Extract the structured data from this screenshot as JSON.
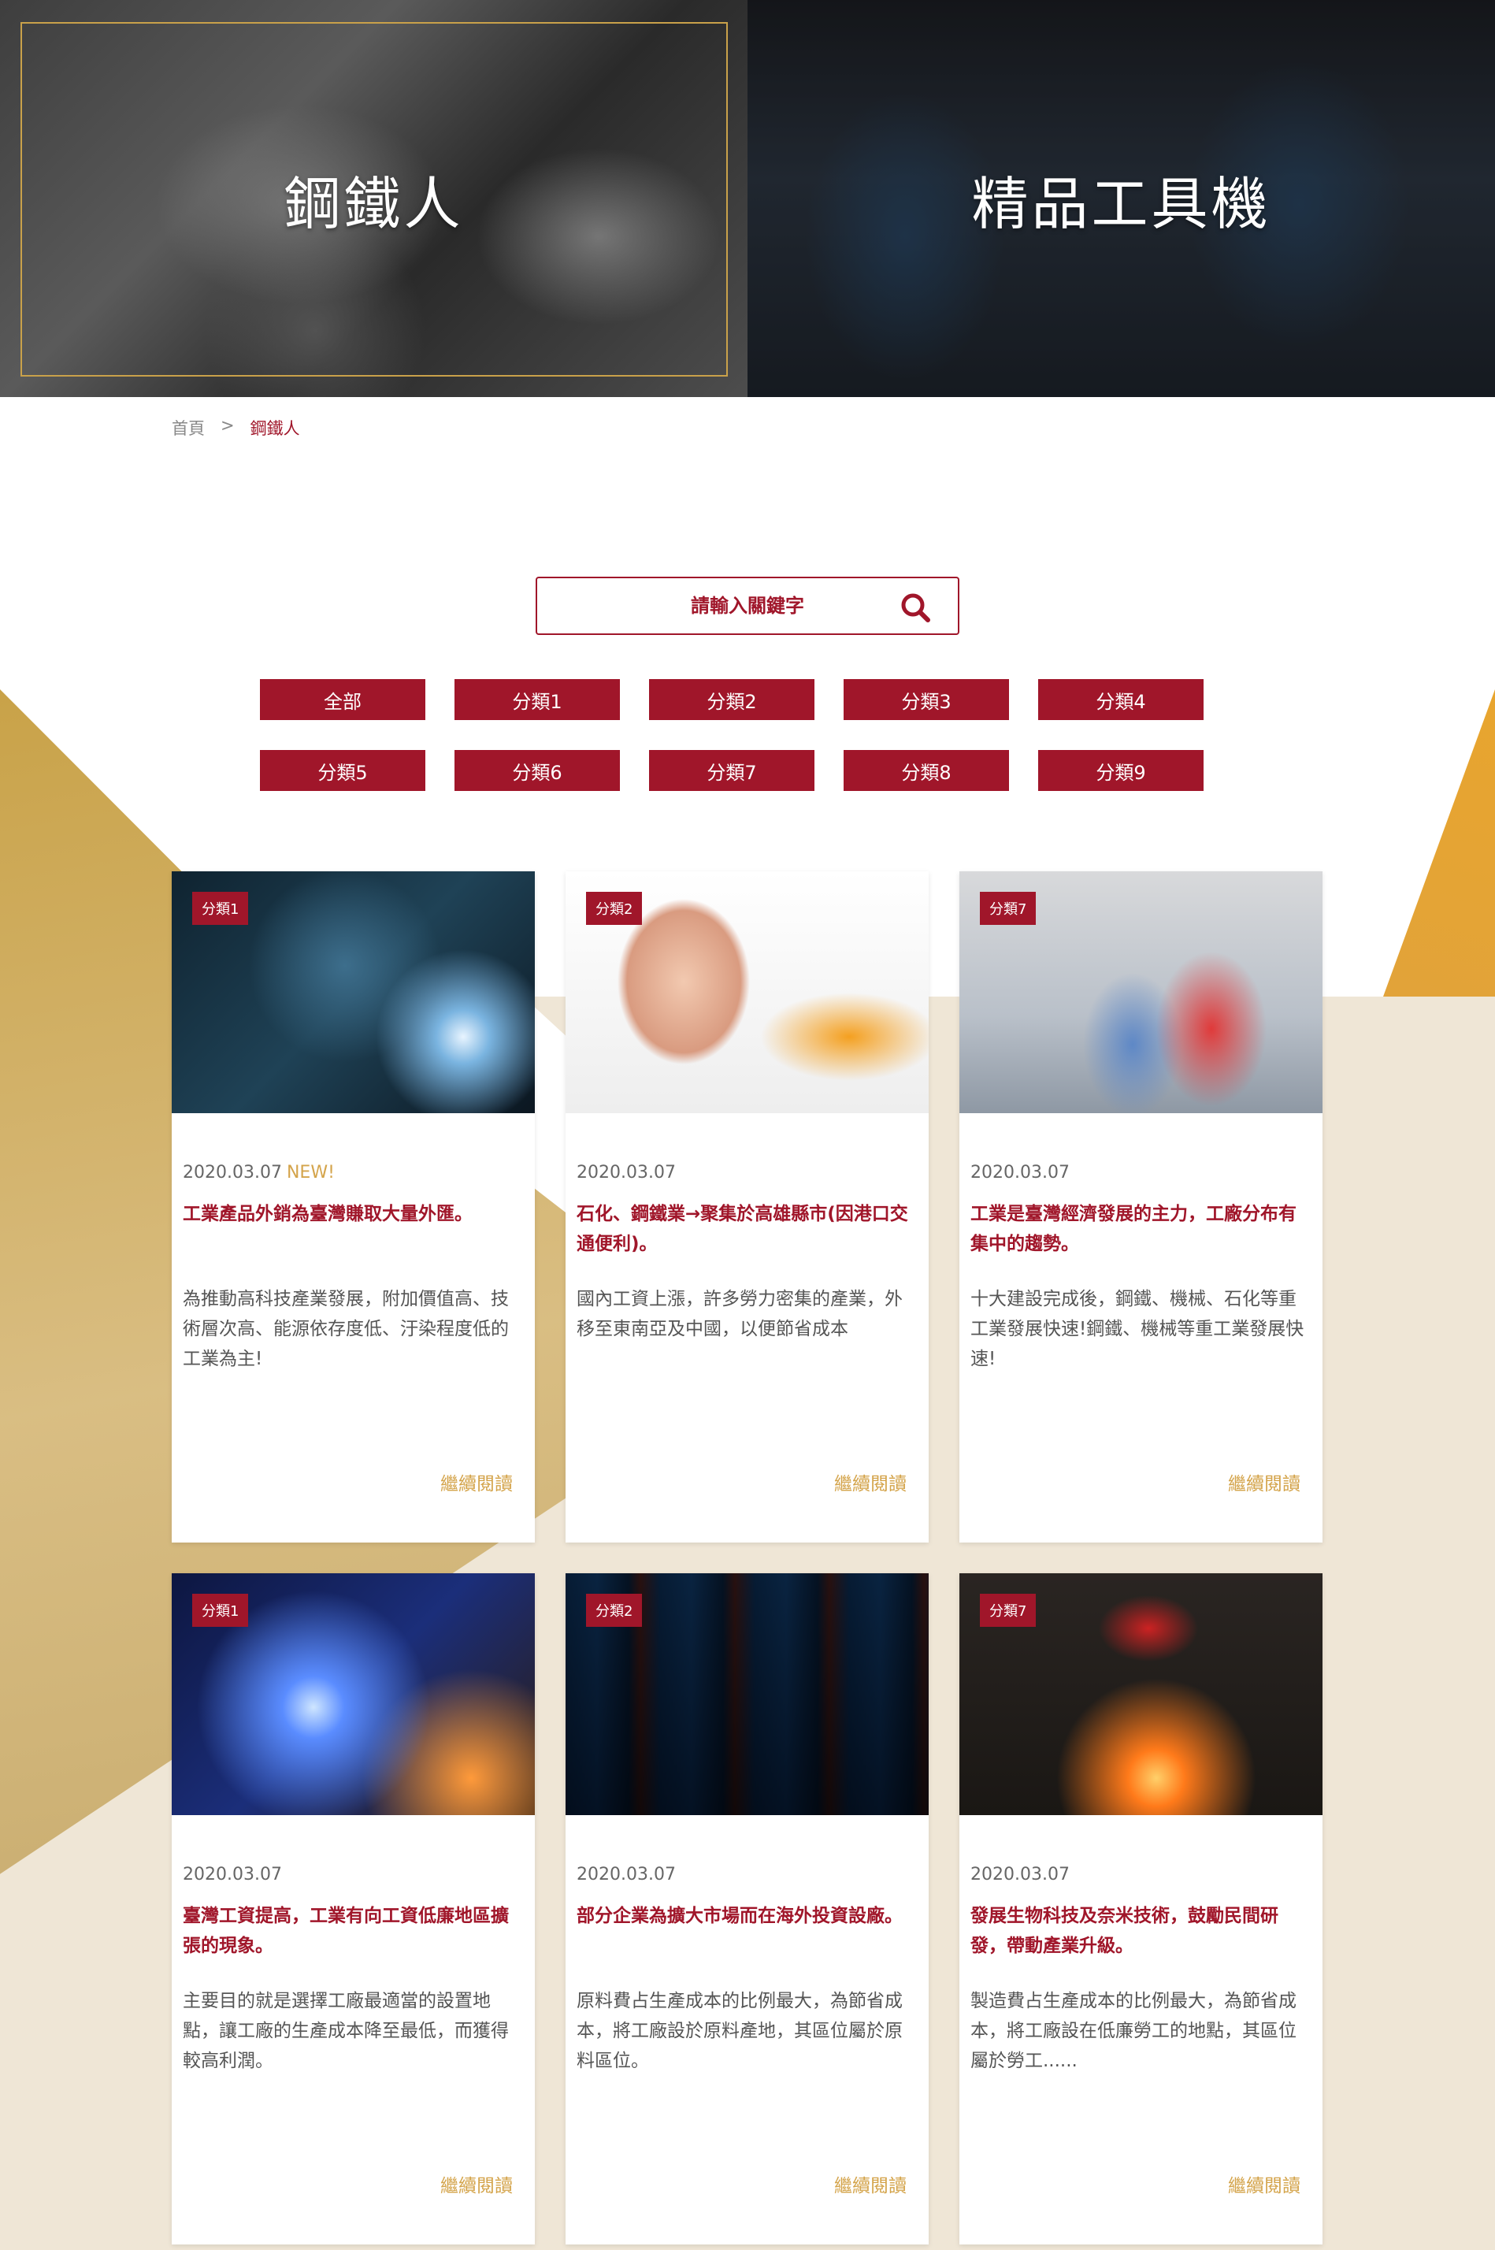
{
  "hero": {
    "left_title": "鋼鐵人",
    "right_title": "精品工具機"
  },
  "breadcrumb": {
    "home": "首頁",
    "separator": ">",
    "current": "鋼鐵人"
  },
  "search": {
    "placeholder": "請輸入關鍵字",
    "icon": "search-icon"
  },
  "categories": [
    "全部",
    "分類1",
    "分類2",
    "分類3",
    "分類4",
    "分類5",
    "分類6",
    "分類7",
    "分類8",
    "分類9"
  ],
  "colors": {
    "primary": "#a0162a",
    "accent_gold": "#d4a44b",
    "frame_gold": "#c9a14a",
    "cream": "#efe6d6"
  },
  "cards": [
    {
      "tag": "分類1",
      "date": "2020.03.07",
      "badge": "NEW!",
      "title": "工業產品外銷為臺灣賺取大量外匯。",
      "description": "為推動高科技產業發展，附加價值高、技術層次高、能源依存度低、汙染程度低的工業為主!",
      "more": "繼續閱讀"
    },
    {
      "tag": "分類2",
      "date": "2020.03.07",
      "badge": "",
      "title": "石化、鋼鐵業→聚集於高雄縣市(因港口交通便利)。",
      "description": "國內工資上漲，許多勞力密集的產業，外移至東南亞及中國，以便節省成本",
      "more": "繼續閱讀"
    },
    {
      "tag": "分類7",
      "date": "2020.03.07",
      "badge": "",
      "title": "工業是臺灣經濟發展的主力，工廠分布有集中的趨勢。",
      "description": "十大建設完成後，鋼鐵、機械、石化等重工業發展快速!鋼鐵、機械等重工業發展快速!",
      "more": "繼續閱讀"
    },
    {
      "tag": "分類1",
      "date": "2020.03.07",
      "badge": "",
      "title": "臺灣工資提高，工業有向工資低廉地區擴張的現象。",
      "description": "主要目的就是選擇工廠最適當的設置地點，讓工廠的生產成本降至最低，而獲得較高利潤。",
      "more": "繼續閱讀"
    },
    {
      "tag": "分類2",
      "date": "2020.03.07",
      "badge": "",
      "title": "部分企業為擴大市場而在海外投資設廠。",
      "description": "原料費占生產成本的比例最大，為節省成本，將工廠設於原料產地，其區位屬於原料區位。",
      "more": "繼續閱讀"
    },
    {
      "tag": "分類7",
      "date": "2020.03.07",
      "badge": "",
      "title": "發展生物科技及奈米技術，鼓勵民間研發，帶動產業升級。",
      "description": "製造費占生產成本的比例最大，為節省成本，將工廠設在低廉勞工的地點，其區位屬於勞工......",
      "more": "繼續閱讀"
    }
  ]
}
